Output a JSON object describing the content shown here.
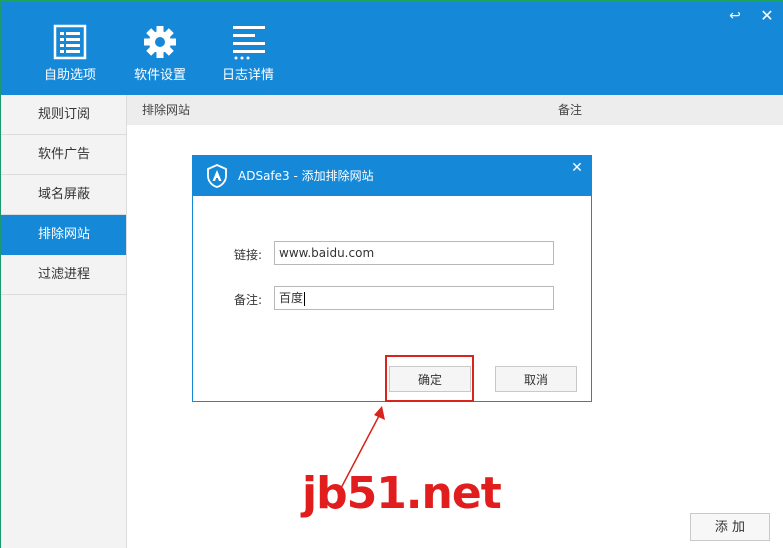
{
  "window": {
    "restore_icon": "↩",
    "close_icon": "✕"
  },
  "toolbar": {
    "items": [
      {
        "label": "自助选项",
        "icon": "list-icon"
      },
      {
        "label": "软件设置",
        "icon": "gear-icon"
      },
      {
        "label": "日志详情",
        "icon": "log-icon"
      }
    ]
  },
  "sidebar": {
    "items": [
      {
        "label": "规则订阅",
        "active": false
      },
      {
        "label": "软件广告",
        "active": false
      },
      {
        "label": "域名屏蔽",
        "active": false
      },
      {
        "label": "排除网站",
        "active": true
      },
      {
        "label": "过滤进程",
        "active": false
      }
    ]
  },
  "table": {
    "col1": "排除网站",
    "col2": "备注"
  },
  "add_button": "添 加",
  "dialog": {
    "title": "ADSafe3 - 添加排除网站",
    "close_icon": "✕",
    "link_label": "链接:",
    "link_value": "www.baidu.com",
    "note_label": "备注:",
    "note_value": "百度",
    "ok_button": "确定",
    "cancel_button": "取消"
  },
  "watermark": "jb51.net",
  "colors": {
    "accent": "#1589d8",
    "annotation": "#d9231d"
  }
}
